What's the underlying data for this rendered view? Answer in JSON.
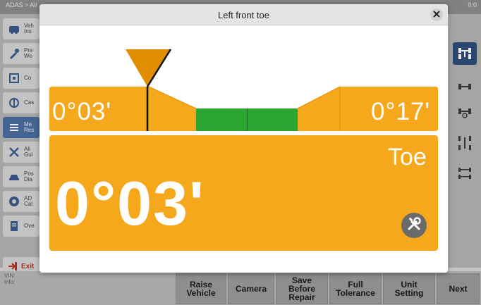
{
  "app": {
    "breadcrumb": "ADAS > Ali",
    "clock": "0:0"
  },
  "sidebar": {
    "items": [
      {
        "label": "Veh\nIns",
        "icon": "car-inspection-icon"
      },
      {
        "label": "Pre\nWo",
        "icon": "wrench-prep-icon"
      },
      {
        "label": "Co",
        "icon": "compensation-icon"
      },
      {
        "label": "Cas",
        "icon": "caster-icon"
      },
      {
        "label": "Me\nRes",
        "icon": "measurement-results-icon"
      },
      {
        "label": "Ali\nGui",
        "icon": "alignment-guide-icon"
      },
      {
        "label": "Pos\nDia",
        "icon": "position-diagram-icon"
      },
      {
        "label": "AD\nCal",
        "icon": "adas-calibration-icon"
      },
      {
        "label": "Ove",
        "icon": "overview-icon"
      }
    ],
    "exit_label": "Exit"
  },
  "right_toolbar": {
    "icons": [
      "front-axle-icon",
      "rear-axle-icon",
      "steering-axle-icon",
      "chassis-icon",
      "four-wheel-icon"
    ]
  },
  "bottom": {
    "vin_text": "VIN:\nInfo:",
    "buttons": [
      {
        "label": "Raise\nVehicle"
      },
      {
        "label": "Camera"
      },
      {
        "label": "Save\nBefore\nRepair"
      },
      {
        "label": "Full\nTolerance"
      },
      {
        "label": "Unit\nSetting"
      },
      {
        "label": "Next"
      }
    ]
  },
  "dialog": {
    "title": "Left front toe",
    "gauge": {
      "min_label": "0°03'",
      "max_label": "0°17'"
    },
    "parameter": "Toe",
    "current_value": "0°03'",
    "colors": {
      "orange": "#f5a81c",
      "green": "#2aa631",
      "pointer": "#e08e00"
    }
  }
}
